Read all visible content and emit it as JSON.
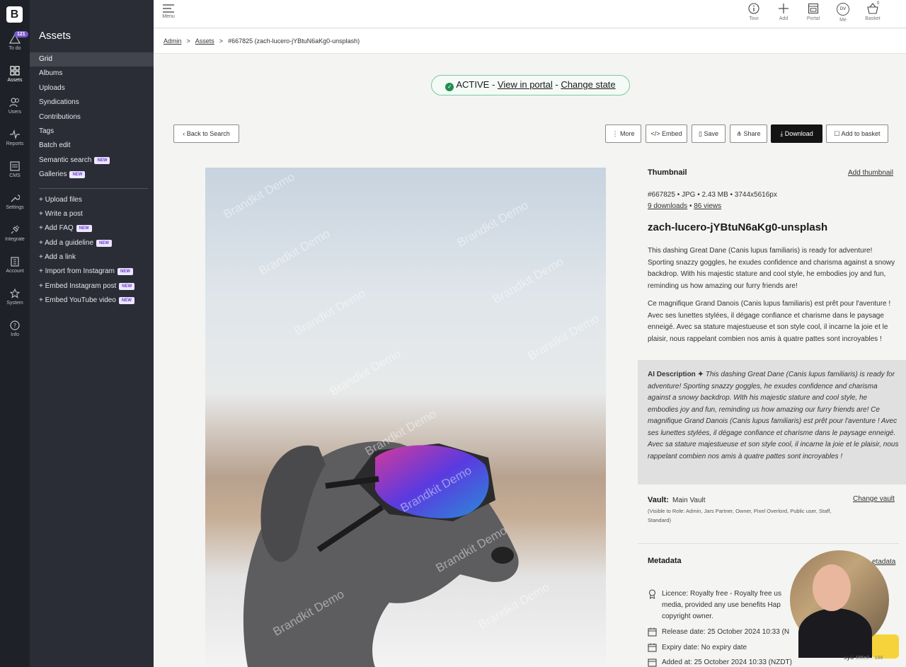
{
  "rail": {
    "logo": "B",
    "todo_count": "121",
    "items": [
      {
        "label": "To do"
      },
      {
        "label": "Assets"
      },
      {
        "label": "Users"
      },
      {
        "label": "Reports"
      },
      {
        "label": "CMS"
      },
      {
        "label": "Settings"
      },
      {
        "label": "Integrate"
      },
      {
        "label": "Account"
      },
      {
        "label": "System"
      },
      {
        "label": "Info"
      }
    ]
  },
  "sidebar": {
    "title": "Assets",
    "new_label": "NEW",
    "items": [
      {
        "label": "Grid"
      },
      {
        "label": "Albums"
      },
      {
        "label": "Uploads"
      },
      {
        "label": "Syndications"
      },
      {
        "label": "Contributions"
      },
      {
        "label": "Tags"
      },
      {
        "label": "Batch edit"
      },
      {
        "label": "Semantic search"
      },
      {
        "label": "Galleries"
      }
    ],
    "actions": [
      {
        "label": "+ Upload files"
      },
      {
        "label": "+ Write a post"
      },
      {
        "label": "+ Add FAQ"
      },
      {
        "label": "+ Add a guideline"
      },
      {
        "label": "+ Add a link"
      },
      {
        "label": "+ Import from Instagram"
      },
      {
        "label": "+ Embed Instagram post"
      },
      {
        "label": "+ Embed YouTube video"
      }
    ]
  },
  "topbar": {
    "menu_label": "Menu",
    "tour": "Tour",
    "add": "Add",
    "portal": "Portal",
    "me": "Me",
    "me_initials": "DV",
    "basket": "Basket",
    "basket_count": "0"
  },
  "breadcrumb": {
    "admin": "Admin",
    "assets": "Assets",
    "current": "#667825 (zach-lucero-jYBtuN6aKg0-unsplash)",
    "separator": ">"
  },
  "status": {
    "state": "ACTIVE",
    "dash": "-",
    "view_portal": "View in portal",
    "change_state": "Change state"
  },
  "toolbar": {
    "back": "Back to Search",
    "more": "More",
    "embed": "Embed",
    "save": "Save",
    "share": "Share",
    "download": "Download",
    "add_basket": "Add to basket"
  },
  "image": {
    "watermark": "Brandkit Demo"
  },
  "details": {
    "thumbnail_label": "Thumbnail",
    "add_thumbnail": "Add thumbnail",
    "file_info": "#667825 • JPG • 2.43 MB • 3744x5616px",
    "downloads": "9 downloads",
    "views_sep": "•",
    "views": "86 views",
    "title": "zach-lucero-jYBtuN6aKg0-unsplash",
    "desc_en": "This dashing Great Dane (Canis lupus familiaris) is ready for adventure! Sporting snazzy goggles, he exudes confidence and charisma against a snowy backdrop. With his majestic stature and cool style, he embodies joy and fun, reminding us how amazing our furry friends are!",
    "desc_fr": "Ce magnifique Grand Danois (Canis lupus familiaris) est prêt pour l'aventure ! Avec ses lunettes stylées, il dégage confiance et charisme dans le paysage enneigé. Avec sa stature majestueuse et son style cool, il incarne la joie et le plaisir, nous rappelant combien nos amis à quatre pattes sont incroyables !",
    "ai_label": "AI Description ✦",
    "ai_text": "This dashing Great Dane (Canis lupus familiaris) is ready for adventure! Sporting snazzy goggles, he exudes confidence and charisma against a snowy backdrop. With his majestic stature and cool style, he embodies joy and fun, reminding us how amazing our furry friends are! Ce magnifique Grand Danois (Canis lupus familiaris) est prêt pour l'aventure ! Avec ses lunettes stylées, il dégage confiance et charisme dans le paysage enneigé. Avec sa stature majestueuse et son style cool, il incarne la joie et le plaisir, nous rappelant combien nos amis à quatre pattes sont incroyables !",
    "vault_label": "Vault:",
    "vault_value": "Main Vault",
    "vault_roles": "(Visible to Role: Admin, Jars Partner, Owner, Pixel Overlord, Public user, Staff, Standard)",
    "change_vault": "Change vault",
    "metadata_label": "Metadata",
    "edit_metadata": "etadata",
    "licence": "Licence: Royalty free - Royalty free us",
    "licence_2": "media, provided any use benefits Hap",
    "licence_3": "copyright owner.",
    "release": "Release date: 25 October 2024 10:33 (N",
    "expiry": "Expiry date: No expiry date",
    "added": "Added at: 25 October 2024 10:33 (NZDT)"
  },
  "overlay": {
    "location": "syd",
    "code": "185e2... 198"
  },
  "colors": {
    "rail_bg": "#1f2128",
    "sidebar_bg": "#2b2d36",
    "accent_purple": "#7b57d1",
    "active_green": "#1e8f4e"
  }
}
